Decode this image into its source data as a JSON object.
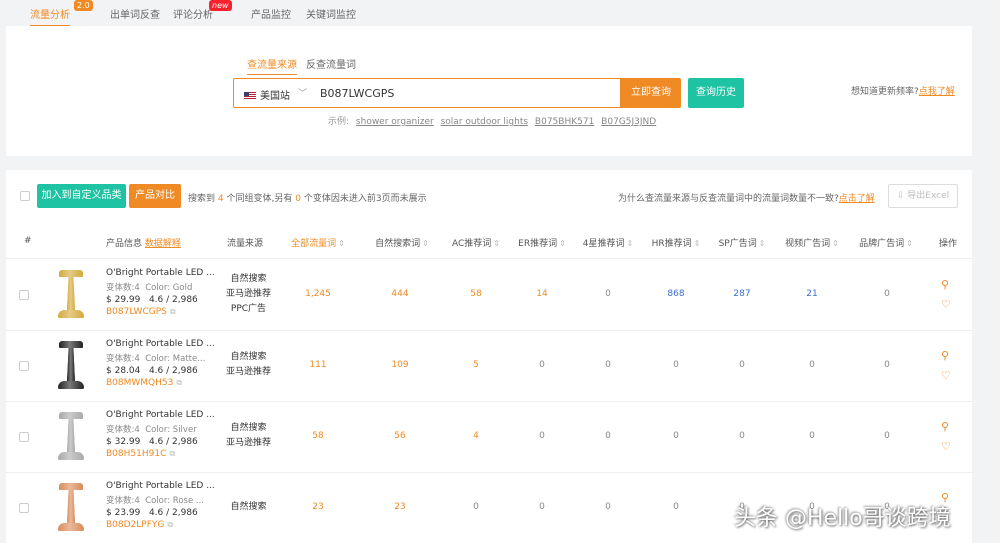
{
  "tabs": [
    {
      "label": "流量分析",
      "badge": "2.0",
      "active": true
    },
    {
      "label": "出单词反查"
    },
    {
      "label": "评论分析",
      "badge": "new"
    },
    {
      "label": "产品监控"
    },
    {
      "label": "关键词监控"
    }
  ],
  "search": {
    "modes": [
      "查流量来源",
      "反查流量词"
    ],
    "site": "美国站",
    "asin_value": "B087LWCGPS",
    "query_button": "立即查询",
    "history_button": "查询历史",
    "freq_text": "想知道更新频率?",
    "freq_link": "点我了解",
    "examples_label": "示例:",
    "examples": [
      "shower organizer",
      "solar outdoor lights",
      "B075BHK571",
      "B07G5J3JND"
    ]
  },
  "results": {
    "add_category_button": "加入到自定义品类",
    "compare_button": "产品对比",
    "summary": {
      "p1": "搜索到",
      "variants": "4",
      "p2": "个同组变体,另有",
      "excluded": "0",
      "p3": "个变体因未进入前3页而未展示"
    },
    "why_text": "为什么查流量来源与反查流量词中的流量词数量不一致?",
    "why_link": "点击了解",
    "export_button": "导出Excel",
    "columns": {
      "index": "#",
      "product_info": "产品信息",
      "data_explain": "数据解释",
      "source": "流量来源",
      "all_keywords": "全部流量词",
      "organic": "自然搜索词",
      "ac": "AC推荐词",
      "er": "ER推荐词",
      "star4": "4星推荐词",
      "hr": "HR推荐词",
      "sp": "SP广告词",
      "video": "视频广告词",
      "brand": "品牌广告词",
      "action": "操作"
    },
    "rows": [
      {
        "name": "O'Bright Portable LED ...",
        "variants": "变体数:4",
        "color": "Color: Gold",
        "price": "$ 29.99",
        "rating": "4.6 / 2,986",
        "asin": "B087LWCGPS",
        "lamp_color": "#d4a93a",
        "sources": [
          "自然搜索",
          "亚马逊推荐",
          "PPC广告"
        ],
        "all": "1,245",
        "organic": "444",
        "ac": "58",
        "er": "14",
        "star4": "0",
        "hr": "868",
        "sp": "287",
        "video": "21",
        "brand": "0"
      },
      {
        "name": "O'Bright Portable LED ...",
        "variants": "变体数:4",
        "color": "Color: Matte...",
        "price": "$ 28.04",
        "rating": "4.6 / 2,986",
        "asin": "B08MWMQH53",
        "lamp_color": "#222222",
        "sources": [
          "自然搜索",
          "亚马逊推荐"
        ],
        "all": "111",
        "organic": "109",
        "ac": "5",
        "er": "0",
        "star4": "0",
        "hr": "0",
        "sp": "0",
        "video": "0",
        "brand": "0"
      },
      {
        "name": "O'Bright Portable LED ...",
        "variants": "变体数:4",
        "color": "Color: Silver",
        "price": "$ 32.99",
        "rating": "4.6 / 2,986",
        "asin": "B08H51H91C",
        "lamp_color": "#a9a9a9",
        "sources": [
          "自然搜索",
          "亚马逊推荐"
        ],
        "all": "58",
        "organic": "56",
        "ac": "4",
        "er": "0",
        "star4": "0",
        "hr": "0",
        "sp": "0",
        "video": "0",
        "brand": "0"
      },
      {
        "name": "O'Bright Portable LED ...",
        "variants": "变体数:4",
        "color": "Color: Rose ...",
        "price": "$ 23.99",
        "rating": "4.6 / 2,986",
        "asin": "B08D2LPFYG",
        "lamp_color": "#d98b5a",
        "sources": [
          "自然搜索"
        ],
        "all": "23",
        "organic": "23",
        "ac": "0",
        "er": "0",
        "star4": "0",
        "hr": "0",
        "sp": "0",
        "video": "0",
        "brand": "0"
      }
    ]
  },
  "watermark": "头条 @Hello哥谈跨境"
}
